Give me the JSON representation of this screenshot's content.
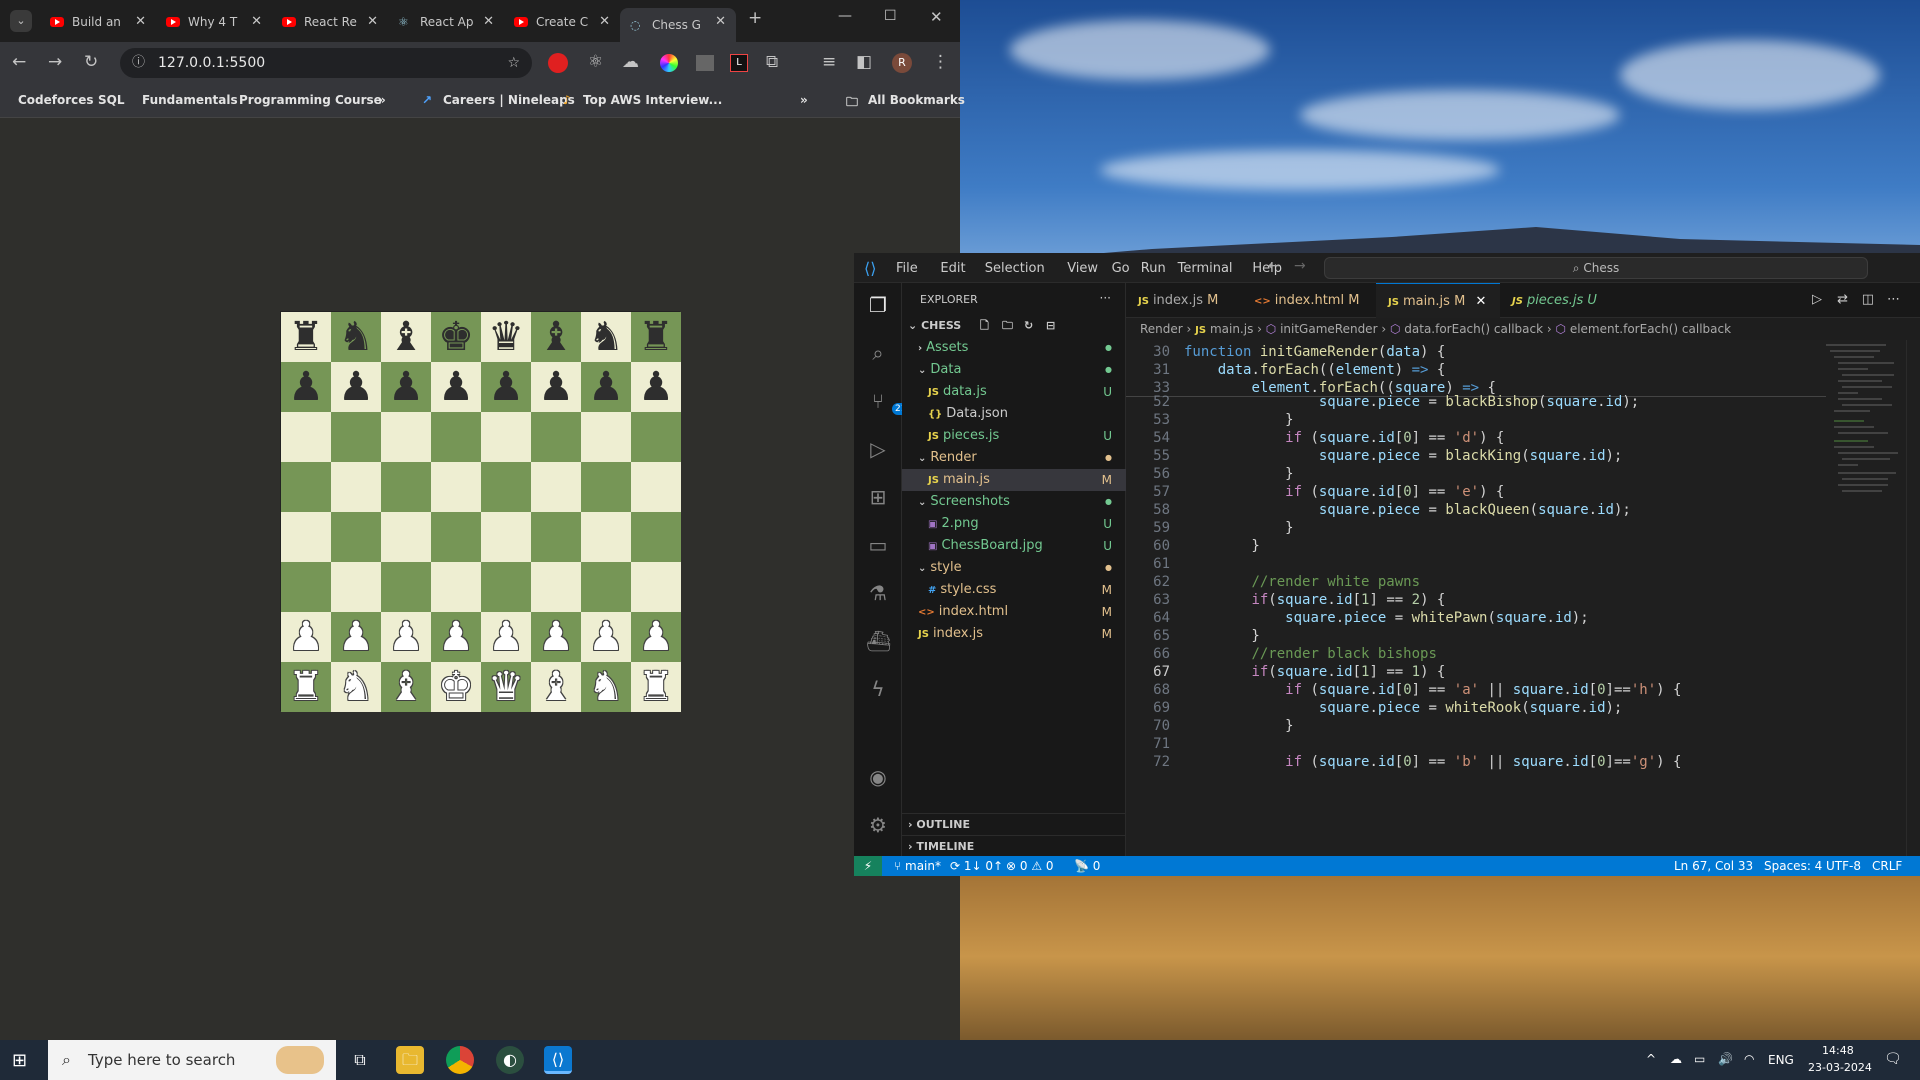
{
  "browser": {
    "tabs": [
      {
        "label": "Build an",
        "icon": "youtube-icon"
      },
      {
        "label": "Why 4 T",
        "icon": "youtube-icon"
      },
      {
        "label": "React Re",
        "icon": "youtube-icon"
      },
      {
        "label": "React Ap",
        "icon": "react-icon"
      },
      {
        "label": "Create C",
        "icon": "youtube-icon"
      },
      {
        "label": "Chess G",
        "icon": "globe-icon"
      }
    ],
    "url": "127.0.0.1:5500",
    "bookmarks": [
      "Codeforces",
      "SQL",
      "Fundamentals",
      "Programming Course",
      "»",
      "Careers | Nineleaps",
      "Top AWS Interview...",
      "»",
      "All Bookmarks"
    ]
  },
  "chessboard": {
    "rows": [
      [
        "♜",
        "♞",
        "♝",
        "♚",
        "♛",
        "♝",
        "♞",
        "♜"
      ],
      [
        "♟",
        "♟",
        "♟",
        "♟",
        "♟",
        "♟",
        "♟",
        "♟"
      ],
      [
        "",
        "",
        "",
        "",
        "",
        "",
        "",
        ""
      ],
      [
        "",
        "",
        "",
        "",
        "",
        "",
        "",
        ""
      ],
      [
        "",
        "",
        "",
        "",
        "",
        "",
        "",
        ""
      ],
      [
        "",
        "",
        "",
        "",
        "",
        "",
        "",
        ""
      ],
      [
        "♟",
        "♟",
        "♟",
        "♟",
        "♟",
        "♟",
        "♟",
        "♟"
      ],
      [
        "♜",
        "♞",
        "♝",
        "♚",
        "♛",
        "♝",
        "♞",
        "♜"
      ]
    ],
    "light_color": "#eeeed2",
    "dark_color": "#769656"
  },
  "vscode": {
    "menu": [
      "File",
      "Edit",
      "Selection",
      "View",
      "Go",
      "Run",
      "Terminal",
      "Help"
    ],
    "search": "Chess",
    "explorer_title": "EXPLORER",
    "explorer_more": "···",
    "root": "CHESS",
    "tree": [
      {
        "label": "Assets",
        "badge": "●",
        "kind": "folder-closed",
        "depth": 1,
        "color": "#73c991"
      },
      {
        "label": "Data",
        "badge": "●",
        "kind": "folder-open",
        "depth": 1,
        "color": "#73c991"
      },
      {
        "label": "data.js",
        "badge": "U",
        "kind": "js",
        "depth": 2,
        "color": "#73c991"
      },
      {
        "label": "Data.json",
        "badge": "",
        "kind": "json",
        "depth": 2,
        "color": "#cccccc"
      },
      {
        "label": "pieces.js",
        "badge": "U",
        "kind": "js",
        "depth": 2,
        "color": "#73c991"
      },
      {
        "label": "Render",
        "badge": "●",
        "kind": "folder-open",
        "depth": 1,
        "color": "#e2c08d"
      },
      {
        "label": "main.js",
        "badge": "M",
        "kind": "js",
        "depth": 2,
        "color": "#e2c08d"
      },
      {
        "label": "Screenshots",
        "badge": "●",
        "kind": "folder-open",
        "depth": 1,
        "color": "#73c991"
      },
      {
        "label": "2.png",
        "badge": "U",
        "kind": "img",
        "depth": 2,
        "color": "#73c991"
      },
      {
        "label": "ChessBoard.jpg",
        "badge": "U",
        "kind": "img",
        "depth": 2,
        "color": "#73c991"
      },
      {
        "label": "style",
        "badge": "●",
        "kind": "folder-open",
        "depth": 1,
        "color": "#e2c08d"
      },
      {
        "label": "style.css",
        "badge": "M",
        "kind": "css",
        "depth": 2,
        "color": "#e2c08d"
      },
      {
        "label": "index.html",
        "badge": "M",
        "kind": "html",
        "depth": 1,
        "color": "#e2c08d"
      },
      {
        "label": "index.js",
        "badge": "M",
        "kind": "js",
        "depth": 1,
        "color": "#e2c08d"
      }
    ],
    "outline": "OUTLINE",
    "timeline": "TIMELINE",
    "editor_tabs": [
      {
        "label": "index.js",
        "status": "M"
      },
      {
        "label": "index.html",
        "status": "M"
      },
      {
        "label": "main.js",
        "status": "M"
      },
      {
        "label": "pieces.js",
        "status": "U"
      }
    ],
    "breadcrumbs": [
      "Render",
      "main.js",
      "initGameRender",
      "data.forEach() callback",
      "element.forEach() callback"
    ],
    "sticky": [
      {
        "n": "30",
        "html": "<span class='kw'>function</span> <span class='fn'>initGameRender</span>(<span class='vr'>data</span>) {"
      },
      {
        "n": "31",
        "html": "    <span class='vr'>data</span>.<span class='fn'>forEach</span>((<span class='vr'>element</span>) <span class='kw'>=&gt;</span> {"
      },
      {
        "n": "33",
        "html": "        <span class='vr'>element</span>.<span class='fn'>forEach</span>((<span class='vr'>square</span>) <span class='kw'>=&gt;</span> {"
      }
    ],
    "lines": [
      {
        "n": "52",
        "html": "                <span class='vr'>square</span>.<span class='vr'>piece</span> = <span class='fn'>blackBishop</span>(<span class='vr'>square</span>.<span class='vr'>id</span>);"
      },
      {
        "n": "53",
        "html": "            }"
      },
      {
        "n": "54",
        "html": "            <span class='kc'>if</span> (<span class='vr'>square</span>.<span class='vr'>id</span>[<span class='nm'>0</span>] == <span class='st'>'d'</span>) {"
      },
      {
        "n": "55",
        "html": "                <span class='vr'>square</span>.<span class='vr'>piece</span> = <span class='fn'>blackKing</span>(<span class='vr'>square</span>.<span class='vr'>id</span>);"
      },
      {
        "n": "56",
        "html": "            }"
      },
      {
        "n": "57",
        "html": "            <span class='kc'>if</span> (<span class='vr'>square</span>.<span class='vr'>id</span>[<span class='nm'>0</span>] == <span class='st'>'e'</span>) {"
      },
      {
        "n": "58",
        "html": "                <span class='vr'>square</span>.<span class='vr'>piece</span> = <span class='fn'>blackQueen</span>(<span class='vr'>square</span>.<span class='vr'>id</span>);"
      },
      {
        "n": "59",
        "html": "            }"
      },
      {
        "n": "60",
        "html": "        }"
      },
      {
        "n": "61",
        "html": ""
      },
      {
        "n": "62",
        "html": "        <span class='cm'>//render white pawns</span>"
      },
      {
        "n": "63",
        "html": "        <span class='kc'>if</span>(<span class='vr'>square</span>.<span class='vr'>id</span>[<span class='nm'>1</span>] == <span class='nm'>2</span>) {"
      },
      {
        "n": "64",
        "html": "            <span class='vr'>square</span>.<span class='vr'>piece</span> = <span class='fn'>whitePawn</span>(<span class='vr'>square</span>.<span class='vr'>id</span>);"
      },
      {
        "n": "65",
        "html": "        }"
      },
      {
        "n": "66",
        "html": "        <span class='cm'>//render black bishops</span>"
      },
      {
        "n": "67",
        "html": "        <span class='kc'>if</span>(<span class='vr'>square</span>.<span class='vr'>id</span>[<span class='nm'>1</span>] == <span class='nm'>1</span>) {"
      },
      {
        "n": "68",
        "html": "            <span class='kc'>if</span> (<span class='vr'>square</span>.<span class='vr'>id</span>[<span class='nm'>0</span>] == <span class='st'>'a'</span> || <span class='vr'>square</span>.<span class='vr'>id</span>[<span class='nm'>0</span>]==<span class='st'>'h'</span>) {"
      },
      {
        "n": "69",
        "html": "                <span class='vr'>square</span>.<span class='vr'>piece</span> = <span class='fn'>whiteRook</span>(<span class='vr'>square</span>.<span class='vr'>id</span>);"
      },
      {
        "n": "70",
        "html": "            }"
      },
      {
        "n": "71",
        "html": ""
      },
      {
        "n": "72",
        "html": "            <span class='kc'>if</span> (<span class='vr'>square</span>.<span class='vr'>id</span>[<span class='nm'>0</span>] == <span class='st'>'b'</span> || <span class='vr'>square</span>.<span class='vr'>id</span>[<span class='nm'>0</span>]==<span class='st'>'g'</span>) {"
      }
    ],
    "status": {
      "branch": "main*",
      "sync": "1↓ 0↑",
      "problems": "⊗ 0 ⚠ 0",
      "ports": "📡 0",
      "cursor": "Ln 67, Col 33",
      "spaces": "Spaces: 4",
      "encoding": "UTF-8",
      "eol": "CRLF"
    },
    "scm_badge": "21"
  },
  "taskbar": {
    "search_placeholder": "Type here to search",
    "lang": "ENG",
    "time": "14:48",
    "date": "23-03-2024"
  }
}
